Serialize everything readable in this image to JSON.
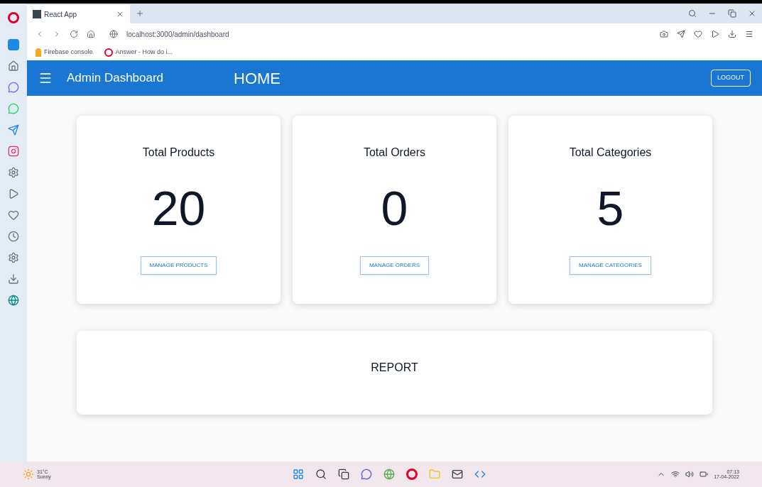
{
  "browser": {
    "tab": {
      "title": "React App",
      "selected": true
    },
    "url": "localhost:3000/admin/dashboard",
    "bookmarks": [
      {
        "label": "Firebase console",
        "kind": "firebase"
      },
      {
        "label": "Answer - How do i...",
        "kind": "opera"
      }
    ]
  },
  "app_bar": {
    "title": "Admin Dashboard",
    "heading": "HOME",
    "logout": "LOGOUT"
  },
  "cards": [
    {
      "title": "Total Products",
      "value": "20",
      "button": "MANAGE PRODUCTS"
    },
    {
      "title": "Total Orders",
      "value": "0",
      "button": "MANAGE ORDERS"
    },
    {
      "title": "Total Categories",
      "value": "5",
      "button": "MANAGE CATEGORIES"
    }
  ],
  "report": {
    "title": "REPORT"
  },
  "taskbar": {
    "temperature": "31°C",
    "weather": "Sunny",
    "time": "07:13",
    "date": "17-04-2022"
  }
}
